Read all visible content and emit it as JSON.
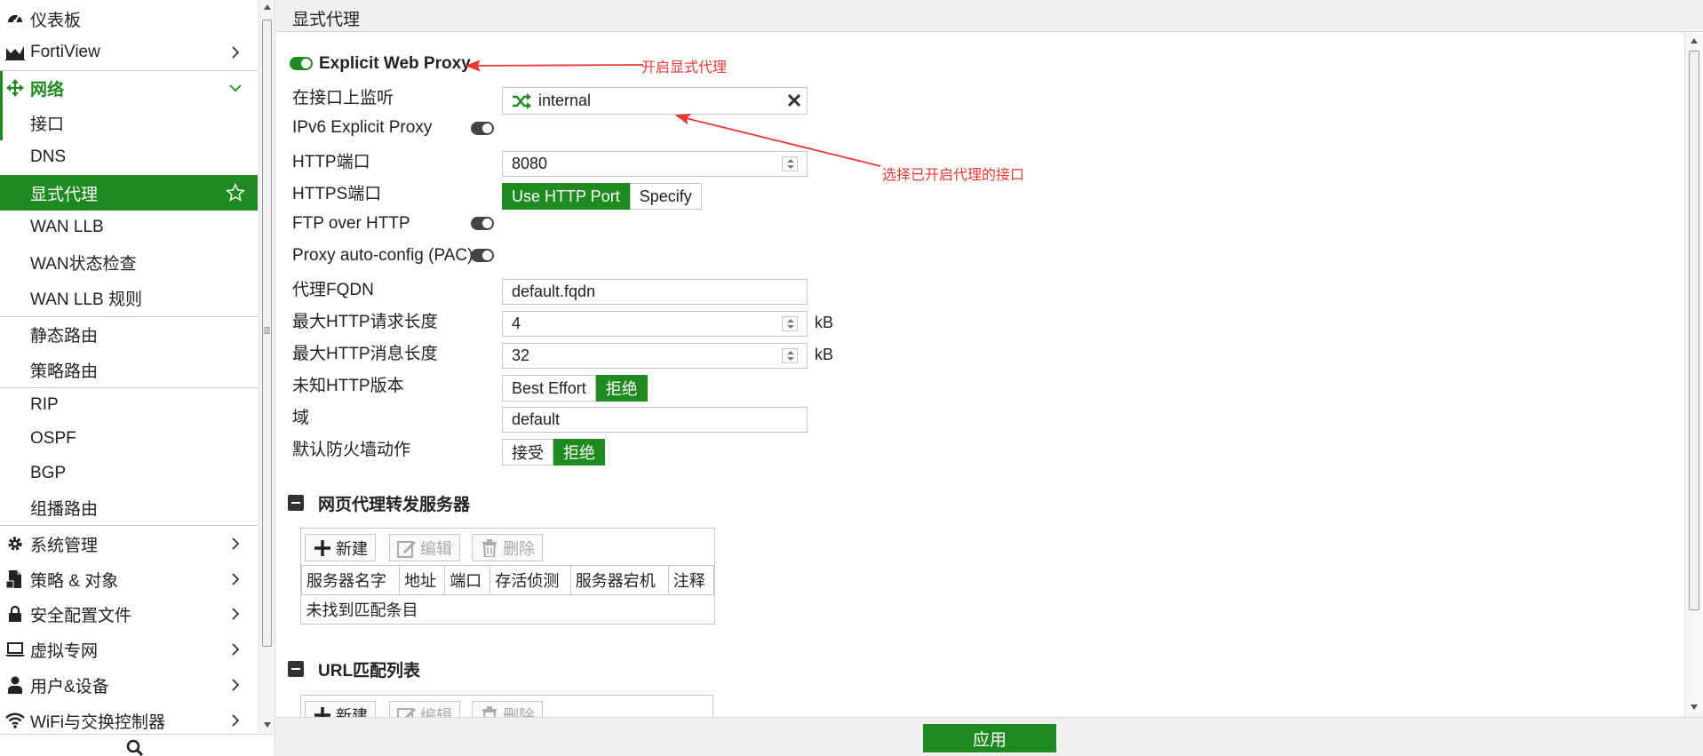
{
  "sidebar": {
    "items": [
      {
        "label": "仪表板",
        "icon": "dashboard-icon"
      },
      {
        "label": "FortiView",
        "icon": "chart-icon"
      },
      {
        "label": "网络",
        "icon": "move-arrows-icon"
      },
      {
        "label": "接口"
      },
      {
        "label": "DNS"
      },
      {
        "label": "显式代理"
      },
      {
        "label": "WAN LLB"
      },
      {
        "label": "WAN状态检查"
      },
      {
        "label": "WAN LLB 规则"
      },
      {
        "label": "静态路由"
      },
      {
        "label": "策略路由"
      },
      {
        "label": "RIP"
      },
      {
        "label": "OSPF"
      },
      {
        "label": "BGP"
      },
      {
        "label": "组播路由"
      },
      {
        "label": "系统管理",
        "icon": "gear-icon"
      },
      {
        "label": "策略 & 对象",
        "icon": "document-icon"
      },
      {
        "label": "安全配置文件",
        "icon": "lock-icon"
      },
      {
        "label": "虚拟专网",
        "icon": "laptop-icon"
      },
      {
        "label": "用户&设备",
        "icon": "user-icon"
      },
      {
        "label": "WiFi与交换控制器",
        "icon": "wifi-icon"
      }
    ]
  },
  "header": {
    "title": "显式代理"
  },
  "form": {
    "explicit_web_proxy": {
      "label": "Explicit Web Proxy",
      "enabled": true
    },
    "listen_interface": {
      "label": "在接口上监听",
      "value": "internal"
    },
    "ipv6_proxy": {
      "label": "IPv6 Explicit Proxy",
      "enabled": false
    },
    "http_port": {
      "label": "HTTP端口",
      "value": "8080"
    },
    "https_port": {
      "label": "HTTPS端口",
      "options": [
        "Use HTTP Port",
        "Specify"
      ],
      "selected": "Use HTTP Port"
    },
    "ftp_over_http": {
      "label": "FTP over HTTP",
      "enabled": false
    },
    "pac": {
      "label": "Proxy auto-config (PAC)",
      "enabled": false
    },
    "fqdn": {
      "label": "代理FQDN",
      "value": "default.fqdn"
    },
    "max_request": {
      "label": "最大HTTP请求长度",
      "value": "4",
      "unit": "kB"
    },
    "max_message": {
      "label": "最大HTTP消息长度",
      "value": "32",
      "unit": "kB"
    },
    "unknown_http": {
      "label": "未知HTTP版本",
      "options": [
        "Best Effort",
        "拒绝"
      ],
      "selected": "拒绝"
    },
    "realm": {
      "label": "域",
      "value": "default"
    },
    "default_fw_action": {
      "label": "默认防火墙动作",
      "options": [
        "接受",
        "拒绝"
      ],
      "selected": "拒绝"
    }
  },
  "forward_servers": {
    "title": "网页代理转发服务器",
    "toolbar": {
      "new": "新建",
      "edit": "编辑",
      "delete": "删除"
    },
    "columns": [
      "服务器名字",
      "地址",
      "端口",
      "存活侦测",
      "服务器宕机",
      "注释"
    ],
    "empty": "未找到匹配条目"
  },
  "url_match": {
    "title": "URL匹配列表",
    "toolbar": {
      "new": "新建",
      "edit": "编辑",
      "delete": "删除"
    }
  },
  "annotations": {
    "enable": "开启显式代理",
    "select_iface": "选择已开启代理的接口"
  },
  "footer": {
    "apply": "应用"
  },
  "colors": {
    "accent": "#1f8a1f",
    "annotation": "#e53935"
  }
}
